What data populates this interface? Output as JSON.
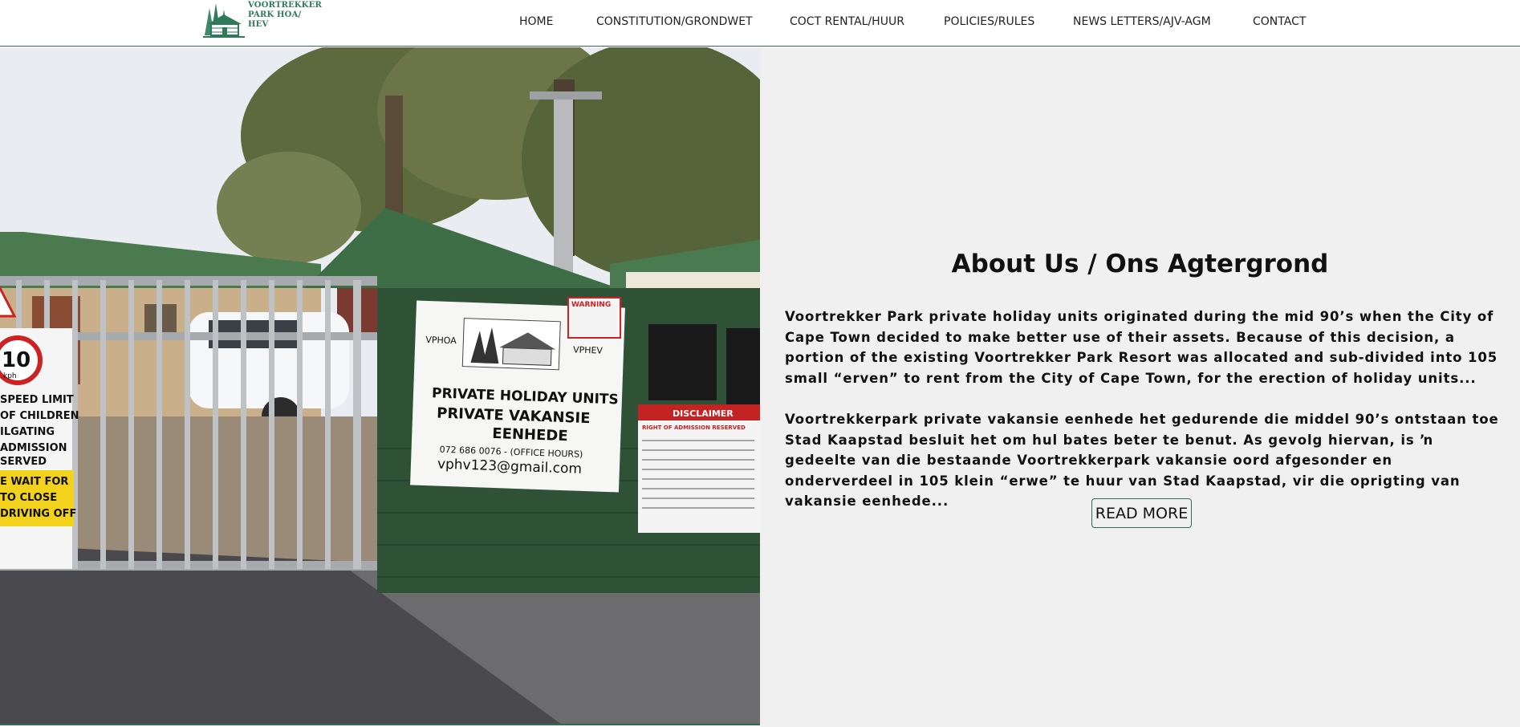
{
  "logo": {
    "line1": "VOORTREKKER",
    "line2": "PARK HOA/ HEV"
  },
  "nav": [
    {
      "label": "HOME"
    },
    {
      "label": "CONSTITUTION/GRONDWET"
    },
    {
      "label": "COCT RENTAL/HUUR"
    },
    {
      "label": "POLICIES/RULES"
    },
    {
      "label": "NEWS LETTERS/AJV-AGM"
    },
    {
      "label": "CONTACT"
    }
  ],
  "hero": {
    "sign_left": "VPHOA",
    "sign_right": "VPHEV",
    "sign_line1": "PRIVATE HOLIDAY UNITS",
    "sign_line2": "PRIVATE  VAKANSIE",
    "sign_line3": "EENHEDE",
    "sign_phone": "072 686 0076 - (OFFICE HOURS)",
    "sign_email": "vphv123@gmail.com",
    "speed_value": "10",
    "speed_unit": "kph",
    "speed_line1": "SPEED LIMIT",
    "speed_line2": "OF CHILDREN",
    "speed_line3": "ILGATING",
    "speed_line4": "ADMISSION",
    "speed_line5": "SERVED",
    "speed_line6": "E WAIT FOR",
    "speed_line7": "TO CLOSE",
    "speed_line8": "DRIVING OFF",
    "warning_label": "WARNING",
    "disclaimer_label": "DISCLAIMER",
    "disclaimer_sub": "RIGHT OF ADMISSION RESERVED"
  },
  "about": {
    "title": "About Us / Ons Agtergrond",
    "para1": "Voortrekker Park private holiday units originated during the mid 90’s when the City of Cape Town decided to make better use of their assets. Because of this decision, a portion of the existing Voortrekker Park Resort was allocated and sub-divided into 105 small “erven” to rent from the City of Cape Town, for the erection of holiday units...",
    "para2": "Voortrekkerpark private vakansie eenhede het gedurende die middel 90’s ontstaan toe Stad Kaapstad besluit het om hul bates beter te benut. As gevolg hiervan, is ŉ gedeelte van die bestaande Voortrekkerpark vakansie oord afgesonder en onderverdeel in 105 klein “erwe” te huur van Stad Kaapstad, vir die oprigting van vakansie eenhede...",
    "read_more": "READ MORE"
  },
  "colors": {
    "brand_green": "#2f6d4f",
    "panel_bg": "#f0f0f0",
    "text": "#111111"
  }
}
